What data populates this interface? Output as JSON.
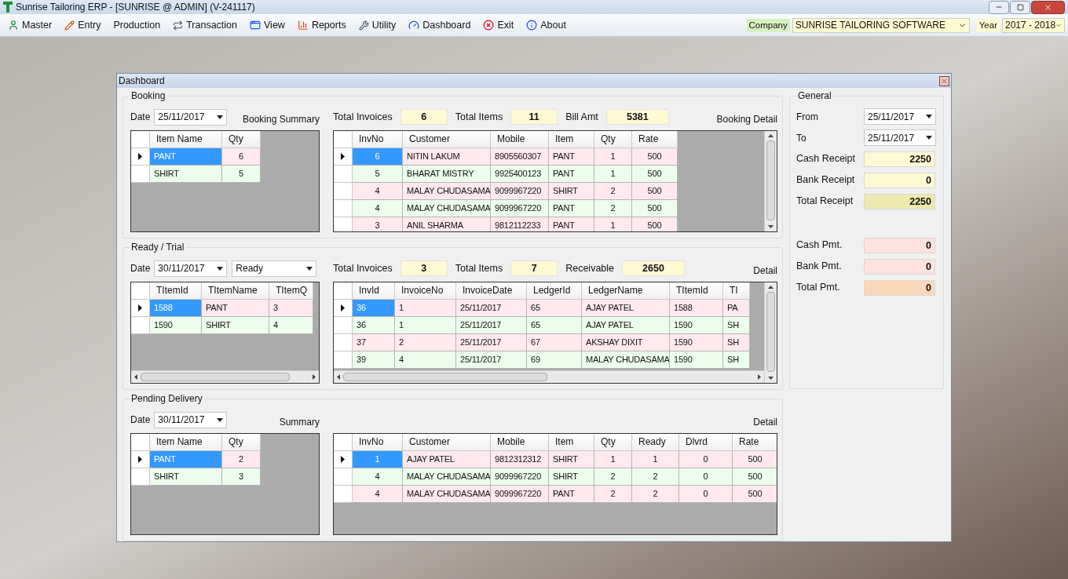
{
  "app": {
    "title": "Sunrise Tailoring ERP - [SUNRISE @ ADMIN] (V-241117)",
    "menu": [
      {
        "label": "Master"
      },
      {
        "label": "Entry"
      },
      {
        "label": "Production"
      },
      {
        "label": "Transaction"
      },
      {
        "label": "View"
      },
      {
        "label": "Reports"
      },
      {
        "label": "Utility"
      },
      {
        "label": "Dashboard"
      },
      {
        "label": "Exit"
      },
      {
        "label": "About"
      }
    ],
    "company_label": "Company",
    "company": "SUNRISE TAILORING SOFTWARE",
    "year_label": "Year",
    "year": "2017 - 2018"
  },
  "dashboard": {
    "title": "Dashboard",
    "booking": {
      "title": "Booking",
      "date_label": "Date",
      "date": "25/11/2017",
      "summary_label": "Booking Summary",
      "detail_label": "Booking Detail",
      "stats": [
        {
          "label": "Total Invoices",
          "value": "6"
        },
        {
          "label": "Total Items",
          "value": "11"
        },
        {
          "label": "Bill Amt",
          "value": "5381"
        }
      ],
      "summary": {
        "columns": [
          "Item Name",
          "Qty"
        ],
        "rows": [
          {
            "cells": [
              "PANT",
              "6"
            ],
            "selected": true
          },
          {
            "cells": [
              "SHIRT",
              "5"
            ],
            "selected": false
          }
        ]
      },
      "detail": {
        "columns": [
          "InvNo",
          "Customer",
          "Mobile",
          "Item",
          "Qty",
          "Rate"
        ],
        "rows": [
          {
            "cells": [
              "6",
              "NITIN LAKUM",
              "8905560307",
              "PANT",
              "1",
              "500"
            ],
            "selected": true
          },
          {
            "cells": [
              "5",
              "BHARAT MISTRY",
              "9925400123",
              "PANT",
              "1",
              "500"
            ],
            "selected": false
          },
          {
            "cells": [
              "4",
              "MALAY CHUDASAMA",
              "9099967220",
              "SHIRT",
              "2",
              "500"
            ],
            "selected": false
          },
          {
            "cells": [
              "4",
              "MALAY CHUDASAMA",
              "9099967220",
              "PANT",
              "2",
              "500"
            ],
            "selected": false
          },
          {
            "cells": [
              "3",
              "ANIL SHARMA",
              "9812112233",
              "PANT",
              "1",
              "500"
            ],
            "selected": false
          }
        ]
      }
    },
    "ready": {
      "title": "Ready / Trial",
      "date_label": "Date",
      "date": "30/11/2017",
      "status": "Ready",
      "detail_label": "Detail",
      "stats": [
        {
          "label": "Total Invoices",
          "value": "3"
        },
        {
          "label": "Total Items",
          "value": "7"
        },
        {
          "label": "Receivable",
          "value": "2650"
        }
      ],
      "summary": {
        "columns": [
          "TItemId",
          "TItemName",
          "TItemQ"
        ],
        "rows": [
          {
            "cells": [
              "1588",
              "PANT",
              "3"
            ],
            "selected": true
          },
          {
            "cells": [
              "1590",
              "SHIRT",
              "4"
            ],
            "selected": false
          }
        ]
      },
      "detail": {
        "columns": [
          "InvId",
          "InvoiceNo",
          "InvoiceDate",
          "LedgerId",
          "LedgerName",
          "TItemId",
          "TI"
        ],
        "rows": [
          {
            "cells": [
              "36",
              "1",
              "25/11/2017",
              "65",
              "AJAY PATEL",
              "1588",
              "PA"
            ],
            "selected": true
          },
          {
            "cells": [
              "36",
              "1",
              "25/11/2017",
              "65",
              "AJAY PATEL",
              "1590",
              "SH"
            ],
            "selected": false
          },
          {
            "cells": [
              "37",
              "2",
              "25/11/2017",
              "67",
              "AKSHAY DIXIT",
              "1590",
              "SH"
            ],
            "selected": false
          },
          {
            "cells": [
              "39",
              "4",
              "25/11/2017",
              "69",
              "MALAY CHUDASAMA",
              "1590",
              "SH"
            ],
            "selected": false
          }
        ]
      }
    },
    "pending": {
      "title": "Pending Delivery",
      "date_label": "Date",
      "date": "30/11/2017",
      "summary_label": "Summary",
      "detail_label": "Detail",
      "summary": {
        "columns": [
          "Item Name",
          "Qty"
        ],
        "rows": [
          {
            "cells": [
              "PANT",
              "2"
            ],
            "selected": true
          },
          {
            "cells": [
              "SHIRT",
              "3"
            ],
            "selected": false
          }
        ]
      },
      "detail": {
        "columns": [
          "InvNo",
          "Customer",
          "Mobile",
          "Item",
          "Qty",
          "Ready",
          "Dlvrd",
          "Rate"
        ],
        "rows": [
          {
            "cells": [
              "1",
              "AJAY PATEL",
              "9812312312",
              "SHIRT",
              "1",
              "1",
              "0",
              "500"
            ],
            "selected": true
          },
          {
            "cells": [
              "4",
              "MALAY CHUDASAMA",
              "9099967220",
              "SHIRT",
              "2",
              "2",
              "0",
              "500"
            ],
            "selected": false
          },
          {
            "cells": [
              "4",
              "MALAY CHUDASAMA",
              "9099967220",
              "PANT",
              "2",
              "2",
              "0",
              "500"
            ],
            "selected": false
          }
        ]
      }
    },
    "general": {
      "title": "General",
      "dates": [
        {
          "label": "From",
          "value": "25/11/2017"
        },
        {
          "label": "To",
          "value": "25/11/2017"
        }
      ],
      "receipts": [
        {
          "label": "Cash Receipt",
          "value": "2250",
          "color": "#fdf9d3"
        },
        {
          "label": "Bank Receipt",
          "value": "0",
          "color": "#fdf9d3"
        },
        {
          "label": "Total Receipt",
          "value": "2250",
          "color": "#ede9ae"
        }
      ],
      "payments": [
        {
          "label": "Cash Pmt.",
          "value": "0",
          "color": "#fde2df"
        },
        {
          "label": "Bank Pmt.",
          "value": "0",
          "color": "#fde2df"
        },
        {
          "label": "Total Pmt.",
          "value": "0",
          "color": "#fdd8b8"
        }
      ]
    }
  }
}
